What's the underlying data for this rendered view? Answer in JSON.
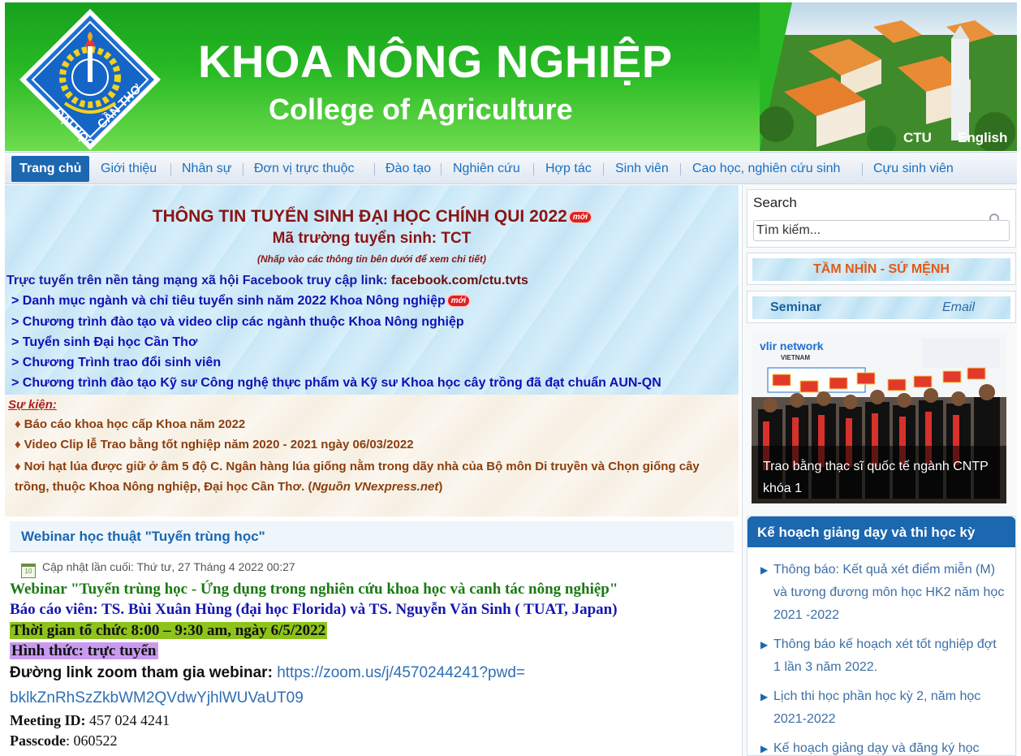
{
  "header": {
    "title": "KHOA NÔNG NGHIỆP",
    "subtitle": "College of Agriculture",
    "logo_text_left": "ĐẠI HỌC",
    "logo_text_right": "CẦN THƠ",
    "links": {
      "ctu": "CTU",
      "english": "English"
    }
  },
  "nav": {
    "items": [
      {
        "label": "Trang chủ"
      },
      {
        "label": "Giới thiệu"
      },
      {
        "label": "Nhân sự"
      },
      {
        "label": "Đơn vị trực thuộc"
      },
      {
        "label": "Đào tạo"
      },
      {
        "label": "Nghiên cứu"
      },
      {
        "label": "Hợp tác"
      },
      {
        "label": "Sinh viên"
      },
      {
        "label": "Cao học, nghiên cứu sinh"
      },
      {
        "label": "Cựu sinh viên"
      }
    ]
  },
  "admission": {
    "title": "THÔNG TIN TUYỂN SINH ĐẠI HỌC CHÍNH QUI 2022",
    "new_badge": "mới",
    "code_line": "Mã trường tuyển sinh: TCT",
    "note": "(Nhấp vào các thông tin bên dưới để xem chi tiết)",
    "fb_text": "Trực tuyến trên nền tảng mạng xã hội Facebook truy cập link: ",
    "fb_link": "facebook.com/ctu.tvts",
    "items": [
      ">  Danh mục ngành và chỉ tiêu tuyển sinh năm 2022 Khoa Nông nghiệp",
      ">  Chương trình đào tạo và video clip  các ngành thuộc Khoa Nông nghiệp",
      ">  Tuyển sinh Đại học Cần Thơ",
      ">  Chương Trình trao đổi sinh viên",
      ">  Chương trình đào tạo Kỹ sư Công nghệ thực phẩm và Kỹ sư Khoa học cây trồng đã đạt chuẩn AUN-QN"
    ]
  },
  "events": {
    "heading": "Sự kiện:",
    "bullet": "♦",
    "items": [
      "Báo cáo khoa học cấp Khoa năm 2022",
      "Video Clip lễ Trao bằng tốt nghiệp năm 2020 - 2021 ngày 06/03/2022"
    ],
    "long_item": "Nơi hạt lúa được giữ ở âm 5 độ C. Ngân hàng lúa giống nằm trong dãy nhà của Bộ môn Di truyền và Chọn giống cây trồng, thuộc Khoa Nông nghiệp, Đại học Cần Thơ. (",
    "long_item_source": "Nguồn VNexpress.net",
    "long_item_end": ")"
  },
  "article": {
    "title": "Webinar học thuật \"Tuyến trùng học\"",
    "calendar_day": "10",
    "updated": "Cập nhật lần cuối: Thứ tư, 27 Tháng 4 2022 00:27",
    "headline": "Webinar \"Tuyến trùng học - Ứng dụng trong nghiên cứu khoa học và canh tác nông nghiệp\"",
    "speakers": "Báo cáo viên:  TS. Bùi Xuân Hùng  (đại học Florida) và TS. Nguyễn Văn Sinh ( TUAT, Japan)",
    "time": "Thời gian  tổ chức  8:00 – 9:30 am, ngày 6/5/2022",
    "format": "Hình thức: trực tuyến",
    "zoom_label": "Đường link zoom tham gia  webinar:  ",
    "zoom_url_1": "https://zoom.us/j/4570244241?pwd=",
    "zoom_url_2": "bklkZnRhSzZkbWM2QVdwYjhlWUVaUT09",
    "meeting_label": "Meeting ID:",
    "meeting_id": " 457 024 4241",
    "passcode_label": "Passcode",
    "passcode": ": 060522"
  },
  "sidebar": {
    "search_label": "Search",
    "search_placeholder": "Tìm kiếm...",
    "vision": "TẦM NHÌN - SỨ MỆNH",
    "seminar": "Seminar",
    "email": "Email",
    "photo_network": "vlir network",
    "photo_country": "VIETNAM",
    "photo_caption": "Trao bằng thạc sĩ quốc tế ngành CNTP khóa 1",
    "plan_title": "Kế hoạch giảng dạy và thi học kỳ",
    "plan_items": [
      "Thông báo: Kết quả xét điểm miễn (M) và tương đương môn học HK2 năm học 2021 -2022",
      "Thông báo kế hoạch xét tốt nghiệp đợt 1 lần 3 năm 2022.",
      "Lịch thi học phần học kỳ 2, năm học 2021-2022",
      "Kế hoạch giảng dạy và đăng ký học"
    ]
  },
  "colors": {
    "banner_green": "#28b924",
    "nav_active": "#1b67b0",
    "admission_title": "#8b1414",
    "admission_links": "#1010b8",
    "events_text": "#8b3f0e",
    "vision_orange": "#e05a16",
    "highlight_green": "#8dc31a",
    "highlight_purple": "#c99af0"
  }
}
